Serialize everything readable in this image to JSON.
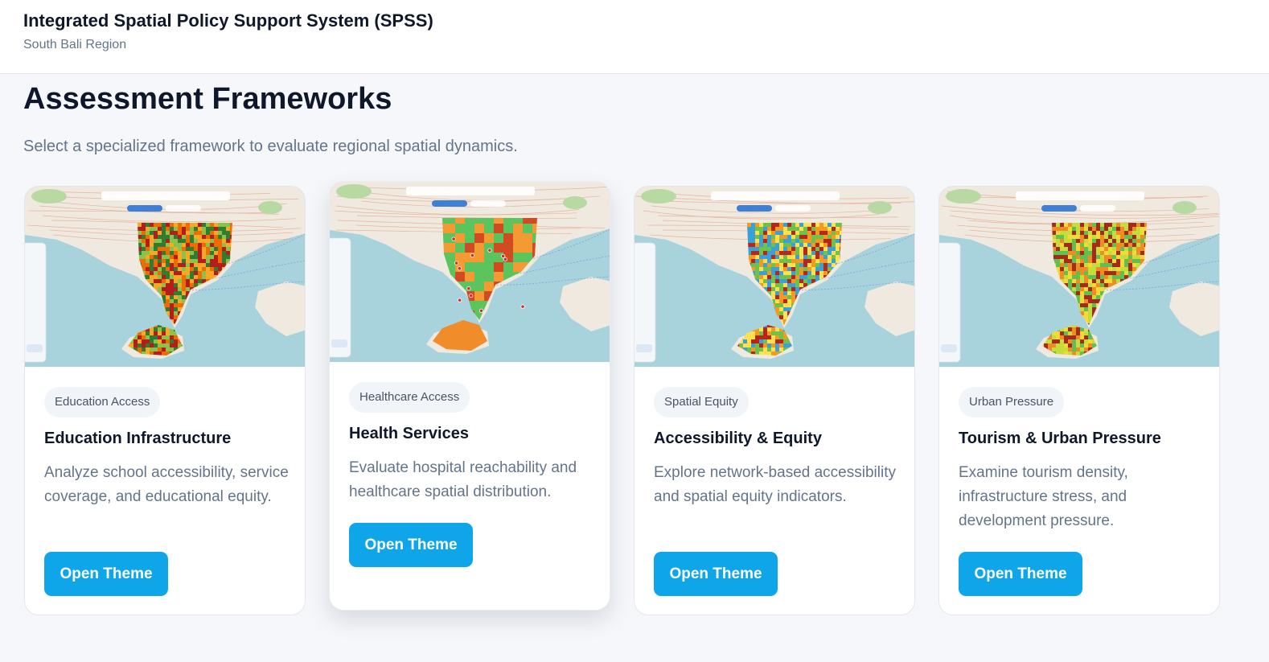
{
  "header": {
    "title": "Integrated Spatial Policy Support System (SPSS)",
    "subtitle": "South Bali Region"
  },
  "main": {
    "title": "Assessment Frameworks",
    "description": "Select a specialized framework to evaluate regional spatial dynamics."
  },
  "cards": [
    {
      "tag": "Education Access",
      "title": "Education Infrastructure",
      "description": "Analyze school accessibility, service coverage, and educational equity.",
      "button": "Open Theme",
      "map_palette": [
        "#2e7d32",
        "#8bc34a",
        "#f9a825",
        "#ef6c00",
        "#b71c1c"
      ]
    },
    {
      "tag": "Healthcare Access",
      "title": "Health Services",
      "description": "Evaluate hospital reachability and healthcare spatial distribution.",
      "button": "Open Theme",
      "map_palette": [
        "#5cc45c",
        "#69cd5a",
        "#f49a32",
        "#f08c2a",
        "#d04a22"
      ]
    },
    {
      "tag": "Spatial Equity",
      "title": "Accessibility & Equity",
      "description": "Explore network-based accessibility and spatial equity indicators.",
      "button": "Open Theme",
      "map_palette": [
        "#3aa0d8",
        "#6cc24a",
        "#ffe14d",
        "#f39a1f",
        "#b8261b"
      ]
    },
    {
      "tag": "Urban Pressure",
      "title": "Tourism & Urban Pressure",
      "description": "Examine tourism density, infrastructure stress, and development pressure.",
      "button": "Open Theme",
      "map_palette": [
        "#5fbf50",
        "#c5dd3a",
        "#f6d837",
        "#ef8c24",
        "#a62a1c"
      ]
    }
  ],
  "colors": {
    "accent": "#0ea5e9",
    "sea": "#a8d3dc",
    "land": "#efe9e0"
  }
}
